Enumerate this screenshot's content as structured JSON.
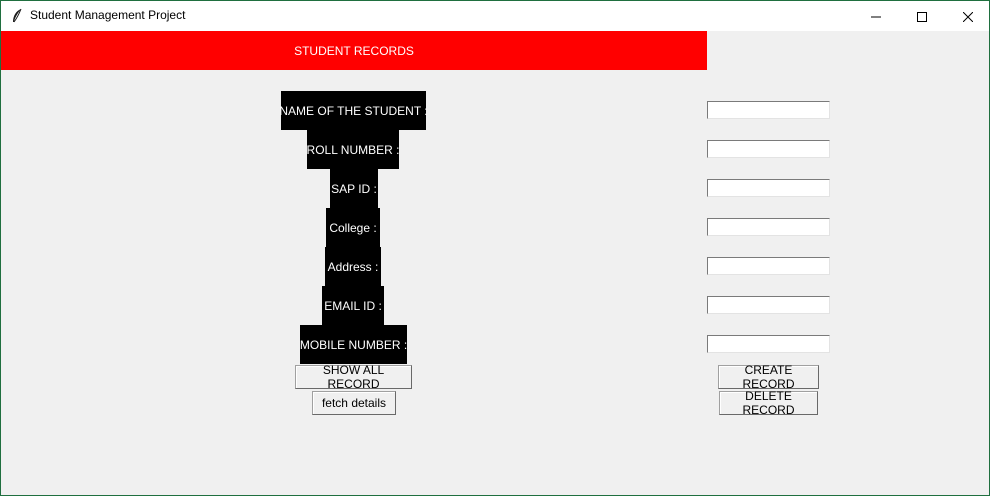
{
  "window": {
    "title": "Student Management Project",
    "icon": "feather-icon",
    "controls": [
      "minimize-icon",
      "maximize-icon",
      "close-icon"
    ]
  },
  "header": {
    "title": "STUDENT RECORDS",
    "color": "#ff0000"
  },
  "form": {
    "fields": [
      {
        "label": "NAME OF THE STUDENT :",
        "value": ""
      },
      {
        "label": "ROLL NUMBER :",
        "value": ""
      },
      {
        "label": "SAP ID :",
        "value": ""
      },
      {
        "label": "College :",
        "value": ""
      },
      {
        "label": "Address :",
        "value": ""
      },
      {
        "label": "EMAIL ID :",
        "value": ""
      },
      {
        "label": "MOBILE NUMBER :",
        "value": ""
      }
    ]
  },
  "buttons": {
    "show_all": "SHOW ALL RECORD",
    "fetch": "fetch details",
    "create": "CREATE RECORD",
    "delete": "DELETE RECORD"
  },
  "colors": {
    "label_bg": "#000000",
    "label_fg": "#ffffff",
    "window_bg": "#f0f0f0"
  }
}
